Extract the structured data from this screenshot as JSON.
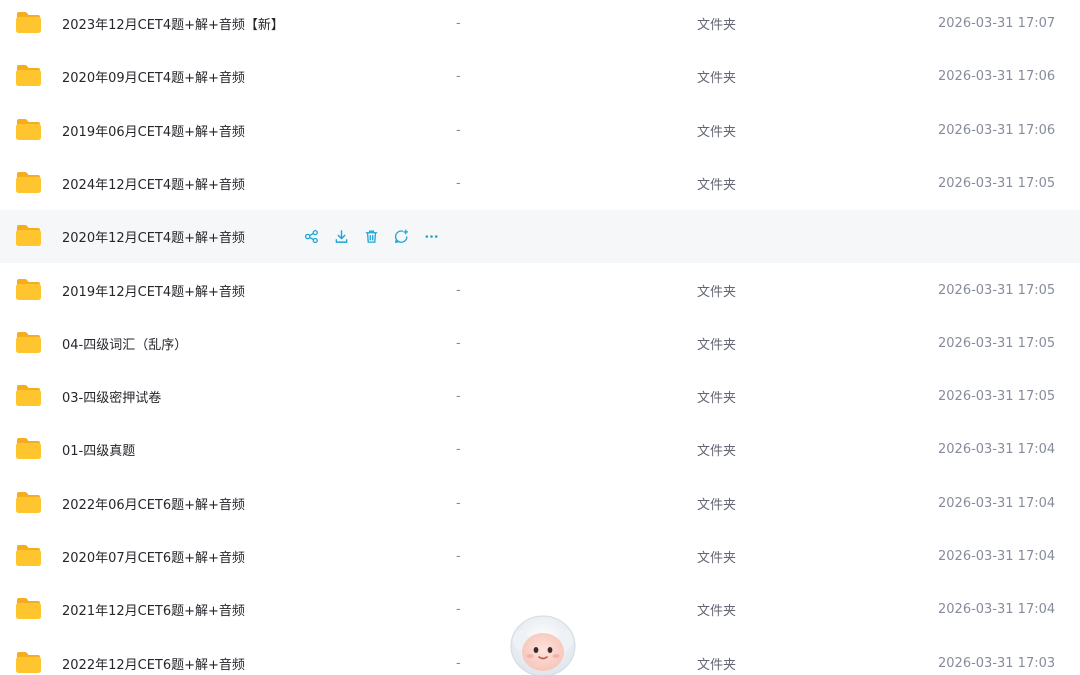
{
  "rows": [
    {
      "name": "2023年12月CET4题+解+音频【新】",
      "size": "-",
      "type": "文件夹",
      "modified": "2026-03-31 17:07"
    },
    {
      "name": "2020年09月CET4题+解+音频",
      "size": "-",
      "type": "文件夹",
      "modified": "2026-03-31 17:06"
    },
    {
      "name": "2019年06月CET4题+解+音频",
      "size": "-",
      "type": "文件夹",
      "modified": "2026-03-31 17:06"
    },
    {
      "name": "2024年12月CET4题+解+音频",
      "size": "-",
      "type": "文件夹",
      "modified": "2026-03-31 17:05"
    },
    {
      "name": "2020年12月CET4题+解+音频",
      "size": "",
      "type": "",
      "modified": "",
      "hovered": true
    },
    {
      "name": "2019年12月CET4题+解+音频",
      "size": "-",
      "type": "文件夹",
      "modified": "2026-03-31 17:05"
    },
    {
      "name": "04-四级词汇（乱序）",
      "size": "-",
      "type": "文件夹",
      "modified": "2026-03-31 17:05"
    },
    {
      "name": "03-四级密押试卷",
      "size": "-",
      "type": "文件夹",
      "modified": "2026-03-31 17:05"
    },
    {
      "name": "01-四级真题",
      "size": "-",
      "type": "文件夹",
      "modified": "2026-03-31 17:04"
    },
    {
      "name": "2022年06月CET6题+解+音频",
      "size": "-",
      "type": "文件夹",
      "modified": "2026-03-31 17:04"
    },
    {
      "name": "2020年07月CET6题+解+音频",
      "size": "-",
      "type": "文件夹",
      "modified": "2026-03-31 17:04"
    },
    {
      "name": "2021年12月CET6题+解+音频",
      "size": "-",
      "type": "文件夹",
      "modified": "2026-03-31 17:04"
    },
    {
      "name": "2022年12月CET6题+解+音频",
      "size": "-",
      "type": "文件夹",
      "modified": "2026-03-31 17:03"
    }
  ],
  "row_actions": [
    "share-icon",
    "download-icon",
    "delete-icon",
    "ai-chat-icon",
    "more-icon"
  ],
  "colors": {
    "folder": "#ffc52e",
    "folder_back": "#f5ad1f",
    "action_icon": "#1aa7d8",
    "hover_bg": "#f6f7f9"
  }
}
